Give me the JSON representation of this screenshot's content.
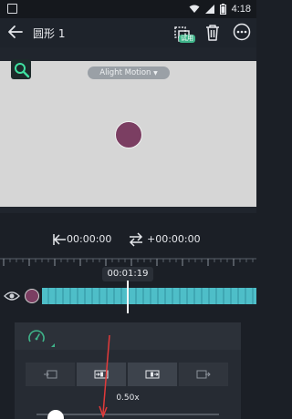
{
  "status_bar": {
    "time": "4:18"
  },
  "header": {
    "title": "圆形 1",
    "trial_badge": "试用"
  },
  "preview": {
    "watermark": "Alight Motion"
  },
  "timeline": {
    "start_time": "00:00:00",
    "duration": "+00:00:00",
    "playhead_time": "00:01:19"
  },
  "speed_panel": {
    "speed_value": "0.50x",
    "speed_fraction": 0.5
  },
  "colors": {
    "accent": "#3fb48a",
    "shape_fill": "#7b3e62",
    "clip": "#4ebec8",
    "annotation_arrow": "#e23a3a"
  },
  "icons": [
    "back-icon",
    "crop-icon",
    "delete-icon",
    "more-icon",
    "edit-icon",
    "eye-icon",
    "speedometer-icon",
    "wifi-icon",
    "signal-icon",
    "battery-icon"
  ]
}
